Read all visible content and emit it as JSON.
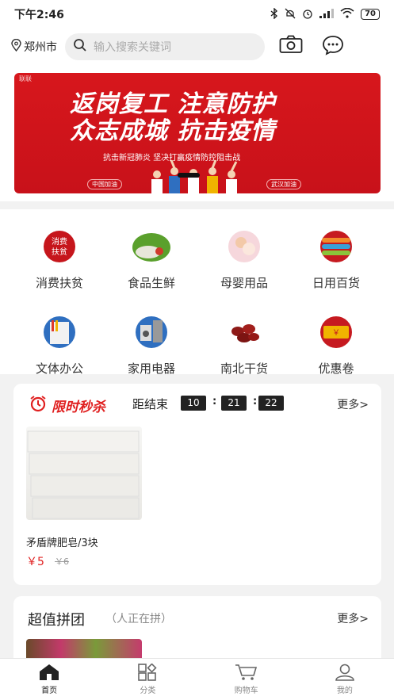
{
  "status_bar": {
    "time": "下午2:46",
    "battery": "70"
  },
  "header": {
    "location": "郑州市",
    "search_placeholder": "输入搜索关键词"
  },
  "banner": {
    "brand": "联联",
    "line1": "返岗复工 注意防护",
    "line2": "众志成城 抗击疫情",
    "line3": "抗击新冠肺炎 坚决打赢疫情防控阻击战",
    "tag_left": "中国加油",
    "tag_right": "武汉加油"
  },
  "categories": [
    {
      "label": "消费扶贫",
      "icon": "poverty-alleviation-icon"
    },
    {
      "label": "食品生鲜",
      "icon": "fresh-food-icon"
    },
    {
      "label": "母婴用品",
      "icon": "baby-products-icon"
    },
    {
      "label": "日用百货",
      "icon": "daily-goods-icon"
    },
    {
      "label": "文体办公",
      "icon": "office-supplies-icon"
    },
    {
      "label": "家用电器",
      "icon": "appliances-icon"
    },
    {
      "label": "南北干货",
      "icon": "dried-goods-icon"
    },
    {
      "label": "优惠卷",
      "icon": "coupon-icon"
    }
  ],
  "flash_sale": {
    "title": "限时秒杀",
    "countdown_label": "距结束",
    "hours": "10",
    "minutes": "21",
    "seconds": "22",
    "more": "更多>",
    "product": {
      "name": "矛盾牌肥皂/3块",
      "price": "￥5",
      "original_price": "￥6"
    }
  },
  "group_buy": {
    "title": "超值拼团",
    "subtitle": "（人正在拼）",
    "more": "更多>"
  },
  "tabbar": [
    {
      "label": "首页",
      "icon": "home-icon",
      "active": true
    },
    {
      "label": "分类",
      "icon": "category-icon",
      "active": false
    },
    {
      "label": "购物车",
      "icon": "cart-icon",
      "active": false
    },
    {
      "label": "我的",
      "icon": "profile-icon",
      "active": false
    }
  ],
  "colors": {
    "accent": "#e02020",
    "banner_red": "#d7171c"
  }
}
